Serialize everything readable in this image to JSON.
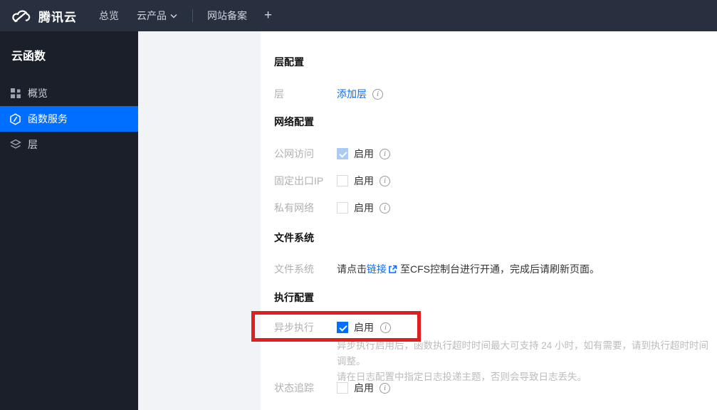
{
  "navbar": {
    "brand": "腾讯云",
    "items": [
      {
        "label": "总览"
      },
      {
        "label": "云产品",
        "has_dropdown": true
      },
      {
        "label": "网站备案"
      }
    ],
    "plus_label": "+"
  },
  "sidebar": {
    "title": "云函数",
    "items": [
      {
        "label": "概览",
        "icon": "grid-icon",
        "active": false
      },
      {
        "label": "函数服务",
        "icon": "function-hexagon-icon",
        "active": true
      },
      {
        "label": "层",
        "icon": "layers-icon",
        "active": false
      }
    ]
  },
  "content": {
    "layer_config": {
      "title": "层配置",
      "layer_label": "层",
      "add_layer_link": "添加层"
    },
    "network_config": {
      "title": "网络配置",
      "rows": [
        {
          "label": "公网访问",
          "checkbox_label": "启用",
          "checked": true,
          "disabled": true
        },
        {
          "label": "固定出口IP",
          "checkbox_label": "启用",
          "checked": false,
          "disabled": false
        },
        {
          "label": "私有网络",
          "checkbox_label": "启用",
          "checked": false,
          "disabled": false
        }
      ]
    },
    "file_system": {
      "title": "文件系统",
      "row_label": "文件系统",
      "text_before_link": "请点击",
      "link_text": "链接",
      "text_after_link": "至CFS控制台进行开通，完成后请刷新页面。"
    },
    "execution_config": {
      "title": "执行配置",
      "async_row": {
        "label": "异步执行",
        "checkbox_label": "启用",
        "checked": true,
        "hint_line1": "异步执行启用后，函数执行超时时间最大可支持 24 小时，如有需要，请到执行超时时间调整。",
        "hint_line2": "请在日志配置中指定日志投递主题，否则会导致日志丢失。"
      },
      "trace_row": {
        "label": "状态追踪",
        "checkbox_label": "启用",
        "checked": false
      }
    }
  },
  "annotation": {
    "type": "red-highlight-rectangle",
    "around": "异步执行 启用 checkbox row",
    "color": "#e01e1e"
  },
  "colors": {
    "accent_blue": "#006eff",
    "navbar_bg": "#28303f",
    "sidebar_bg": "#1a1f29",
    "gray_panel": "#f2f3f6",
    "disabled_checked_checkbox": "#a9cbf5",
    "label_gray": "#b0b0b0"
  }
}
